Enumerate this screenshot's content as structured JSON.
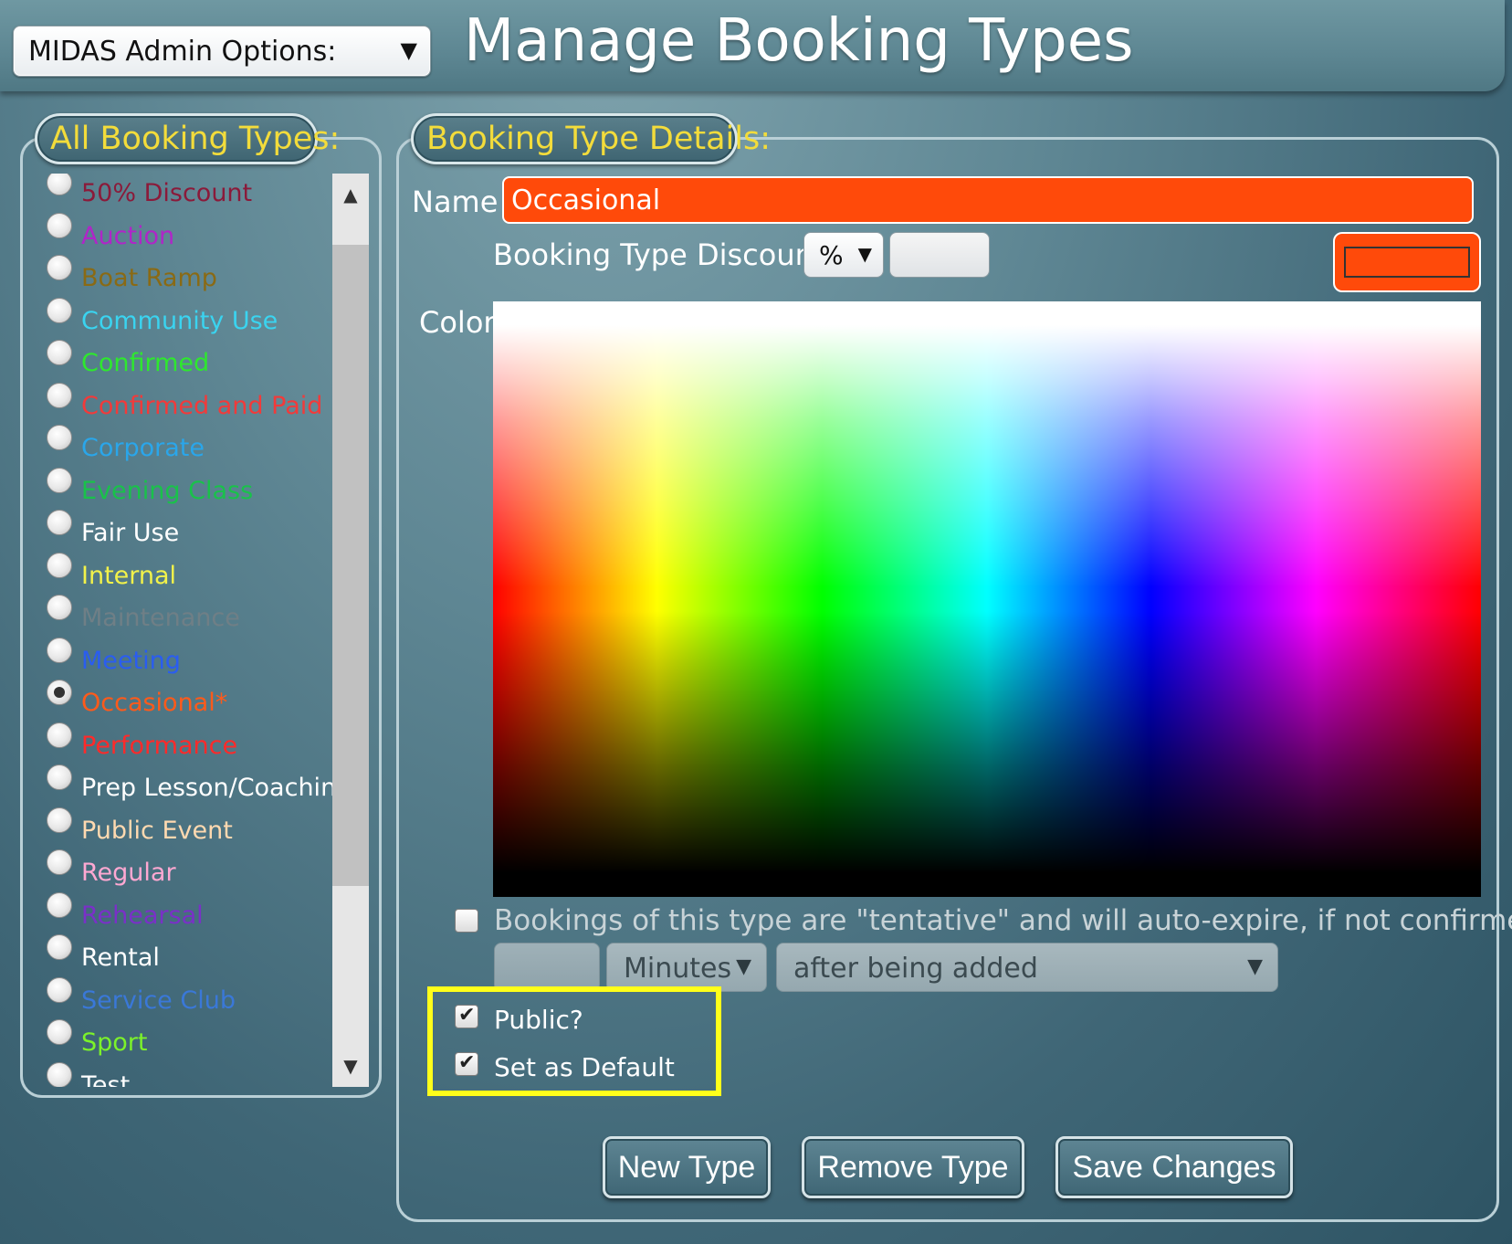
{
  "header": {
    "admin_select": "MIDAS Admin Options:",
    "title": "Manage Booking Types"
  },
  "list_panel": {
    "legend": "All Booking Types:",
    "items": [
      {
        "label": "50% Discount",
        "color": "#8b1a3a",
        "selected": false
      },
      {
        "label": "Auction",
        "color": "#b025c8",
        "selected": false
      },
      {
        "label": "Boat Ramp",
        "color": "#8a6a14",
        "selected": false
      },
      {
        "label": "Community Use",
        "color": "#3ad4f0",
        "selected": false
      },
      {
        "label": "Confirmed",
        "color": "#2ee82e",
        "selected": false
      },
      {
        "label": "Confirmed and Paid",
        "color": "#f23a3a",
        "selected": false
      },
      {
        "label": "Corporate",
        "color": "#2aa6ea",
        "selected": false
      },
      {
        "label": "Evening Class",
        "color": "#19c24a",
        "selected": false
      },
      {
        "label": "Fair Use",
        "color": "#ffffff",
        "selected": false
      },
      {
        "label": "Internal",
        "color": "#f2f24a",
        "selected": false
      },
      {
        "label": "Maintenance",
        "color": "#6f7f86",
        "selected": false
      },
      {
        "label": "Meeting",
        "color": "#2a5df0",
        "selected": false
      },
      {
        "label": "Occasional*",
        "color": "#ff5a1a",
        "selected": true
      },
      {
        "label": "Performance",
        "color": "#ff2a2a",
        "selected": false
      },
      {
        "label": "Prep Lesson/Coaching",
        "color": "#ffffff",
        "selected": false
      },
      {
        "label": "Public Event",
        "color": "#ffd9b0",
        "selected": false
      },
      {
        "label": "Regular",
        "color": "#ffa8d2",
        "selected": false
      },
      {
        "label": "Rehearsal",
        "color": "#7a30c8",
        "selected": false
      },
      {
        "label": "Rental",
        "color": "#ffffff",
        "selected": false
      },
      {
        "label": "Service Club",
        "color": "#3a78d8",
        "selected": false
      },
      {
        "label": "Sport",
        "color": "#7cf22a",
        "selected": false
      },
      {
        "label": "Test",
        "color": "#ffffff",
        "selected": false
      }
    ]
  },
  "details_panel": {
    "legend": "Booking Type Details:",
    "name_label": "Name",
    "name_value": "Occasional",
    "discount_label": "Booking Type Discount",
    "discount_unit": "%",
    "discount_value": "",
    "color_label": "Color",
    "selected_color": "#ff4a0a",
    "tentative_label": "Bookings of this type are \"tentative\" and will auto-expire, if not confirmed:",
    "tentative_checked": false,
    "expire_amount": "",
    "expire_unit": "Minutes",
    "expire_when": "after being added",
    "public_label": "Public?",
    "public_checked": true,
    "default_label": "Set as Default",
    "default_checked": true
  },
  "actions": {
    "new_label": "New Type",
    "remove_label": "Remove Type",
    "save_label": "Save Changes"
  },
  "icons": {
    "dropdown": "triangle-down-icon",
    "scroll_up": "triangle-up-icon",
    "scroll_down": "triangle-down-icon",
    "check": "checkmark-icon"
  }
}
